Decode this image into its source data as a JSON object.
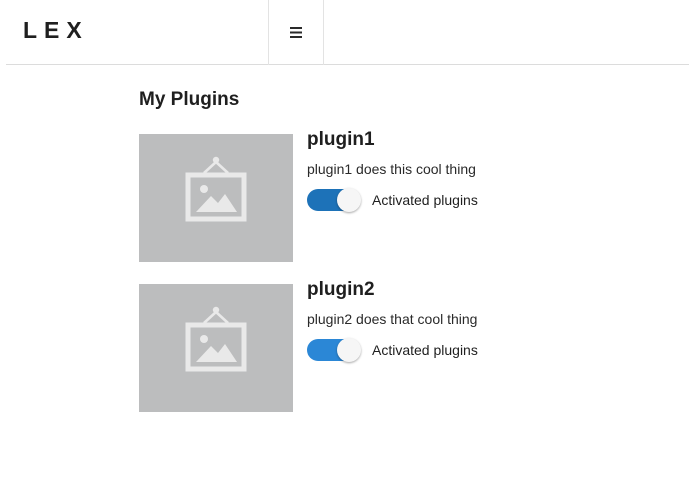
{
  "header": {
    "logo": "LEX",
    "menu_icon": "hamburger-menu-icon"
  },
  "main": {
    "title": "My Plugins",
    "plugins": [
      {
        "name": "plugin1",
        "description": "plugin1 does this cool thing",
        "toggle_label": "Activated plugins",
        "activated": true,
        "toggle_color": "#1d72b8",
        "thumbnail_icon": "image-placeholder-icon"
      },
      {
        "name": "plugin2",
        "description": "plugin2 does that cool thing",
        "toggle_label": "Activated plugins",
        "activated": true,
        "toggle_color": "#2b87d6",
        "thumbnail_icon": "image-placeholder-icon"
      }
    ]
  },
  "colors": {
    "thumbnail_bg": "#bcbdbe",
    "divider": "#dcdcdc"
  }
}
